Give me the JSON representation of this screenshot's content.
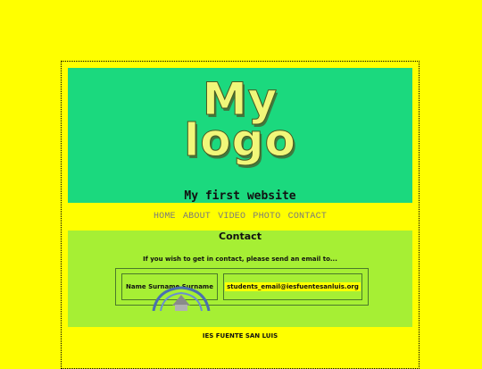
{
  "header": {
    "logo_line1": "My",
    "logo_line2": "logo",
    "site_title": "My first website"
  },
  "nav": {
    "items": [
      "HOME",
      "ABOUT",
      "VIDEO",
      "PHOTO",
      "CONTACT"
    ]
  },
  "content": {
    "heading": "Contact",
    "intro": "If you wish to get in contact, please send an email to...",
    "name": "Name Surname Surname",
    "email": "students_email@iesfuentesanluis.org"
  },
  "footer": {
    "school": "IES FUENTE SAN LUIS"
  },
  "colors": {
    "background": "#ffff00",
    "header": "#1bd97e",
    "content": "#a6ef34",
    "logo_text": "#f0f77a"
  }
}
